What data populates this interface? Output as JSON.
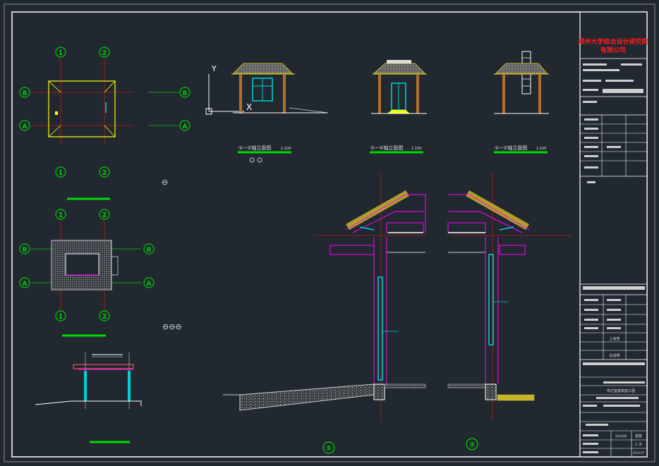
{
  "drawing": {
    "background": "#212830",
    "colors": {
      "frame": "#ffffff",
      "grid_bubble": "#00c800",
      "title_underline": "#00dc00",
      "axis_line": "#b41e1e",
      "wall": "#ff00ff",
      "glass": "#00d2d2",
      "roof_tile": "#c8b428",
      "roof_fill": "#6e6e6e",
      "company_red": "#ff1e1e",
      "column": "#b46e28"
    },
    "grid_labels": {
      "col1": "1",
      "col2": "2",
      "rowA": "A",
      "rowB": "B"
    },
    "elevations": [
      {
        "title": "①~②轴立面图",
        "scale": "1:100"
      },
      {
        "title": "①~②轴立面图",
        "scale": "1:100"
      },
      {
        "title": "①~②轴立面图",
        "scale": "1:100"
      }
    ],
    "section_markers": [
      "①",
      "②"
    ],
    "ucs_labels": {
      "y": "Y",
      "x": "X"
    },
    "misc_symbols": {
      "circle_single": "⊖",
      "circle_triple": "⊖⊖⊖"
    }
  },
  "title_block": {
    "company_line1": "郑州大学综合设计研究院",
    "company_line2": "有限公司",
    "table_text_1": "上会签",
    "table_text_2": "总说明",
    "drawing_name": "传达室建筑施工图",
    "sheet_no": "1 /5",
    "label_a": "建施",
    "label_b": "设计阶段",
    "date": "2014.07"
  }
}
